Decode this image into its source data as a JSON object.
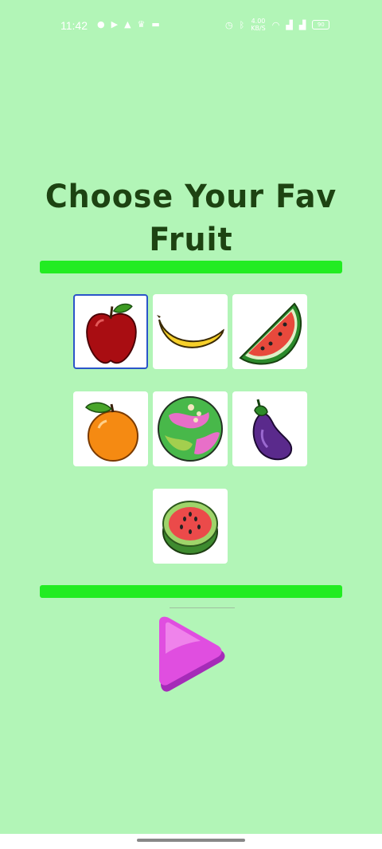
{
  "status_bar": {
    "time": "11:42",
    "left_icons": [
      "chat-icon",
      "youtube-icon",
      "drive-icon",
      "crown-icon",
      "flag-icon"
    ],
    "network_speed": "4.00\nKB/S",
    "battery": "90"
  },
  "title": "Choose Your Fav Fruit",
  "fruits": [
    {
      "name": "apple",
      "selected": true
    },
    {
      "name": "banana",
      "selected": false
    },
    {
      "name": "watermelon-slice",
      "selected": false
    },
    {
      "name": "orange",
      "selected": false
    },
    {
      "name": "candy-ball",
      "selected": false
    },
    {
      "name": "eggplant",
      "selected": false
    },
    {
      "name": "watermelon-round",
      "selected": false
    }
  ],
  "colors": {
    "background": "#b2f5b7",
    "title": "#1d4312",
    "progress_bar": "#22ec22",
    "selection_border": "#2b55c9",
    "play_button": "#e04ee0"
  },
  "icons": {
    "play_button": "play-icon"
  }
}
